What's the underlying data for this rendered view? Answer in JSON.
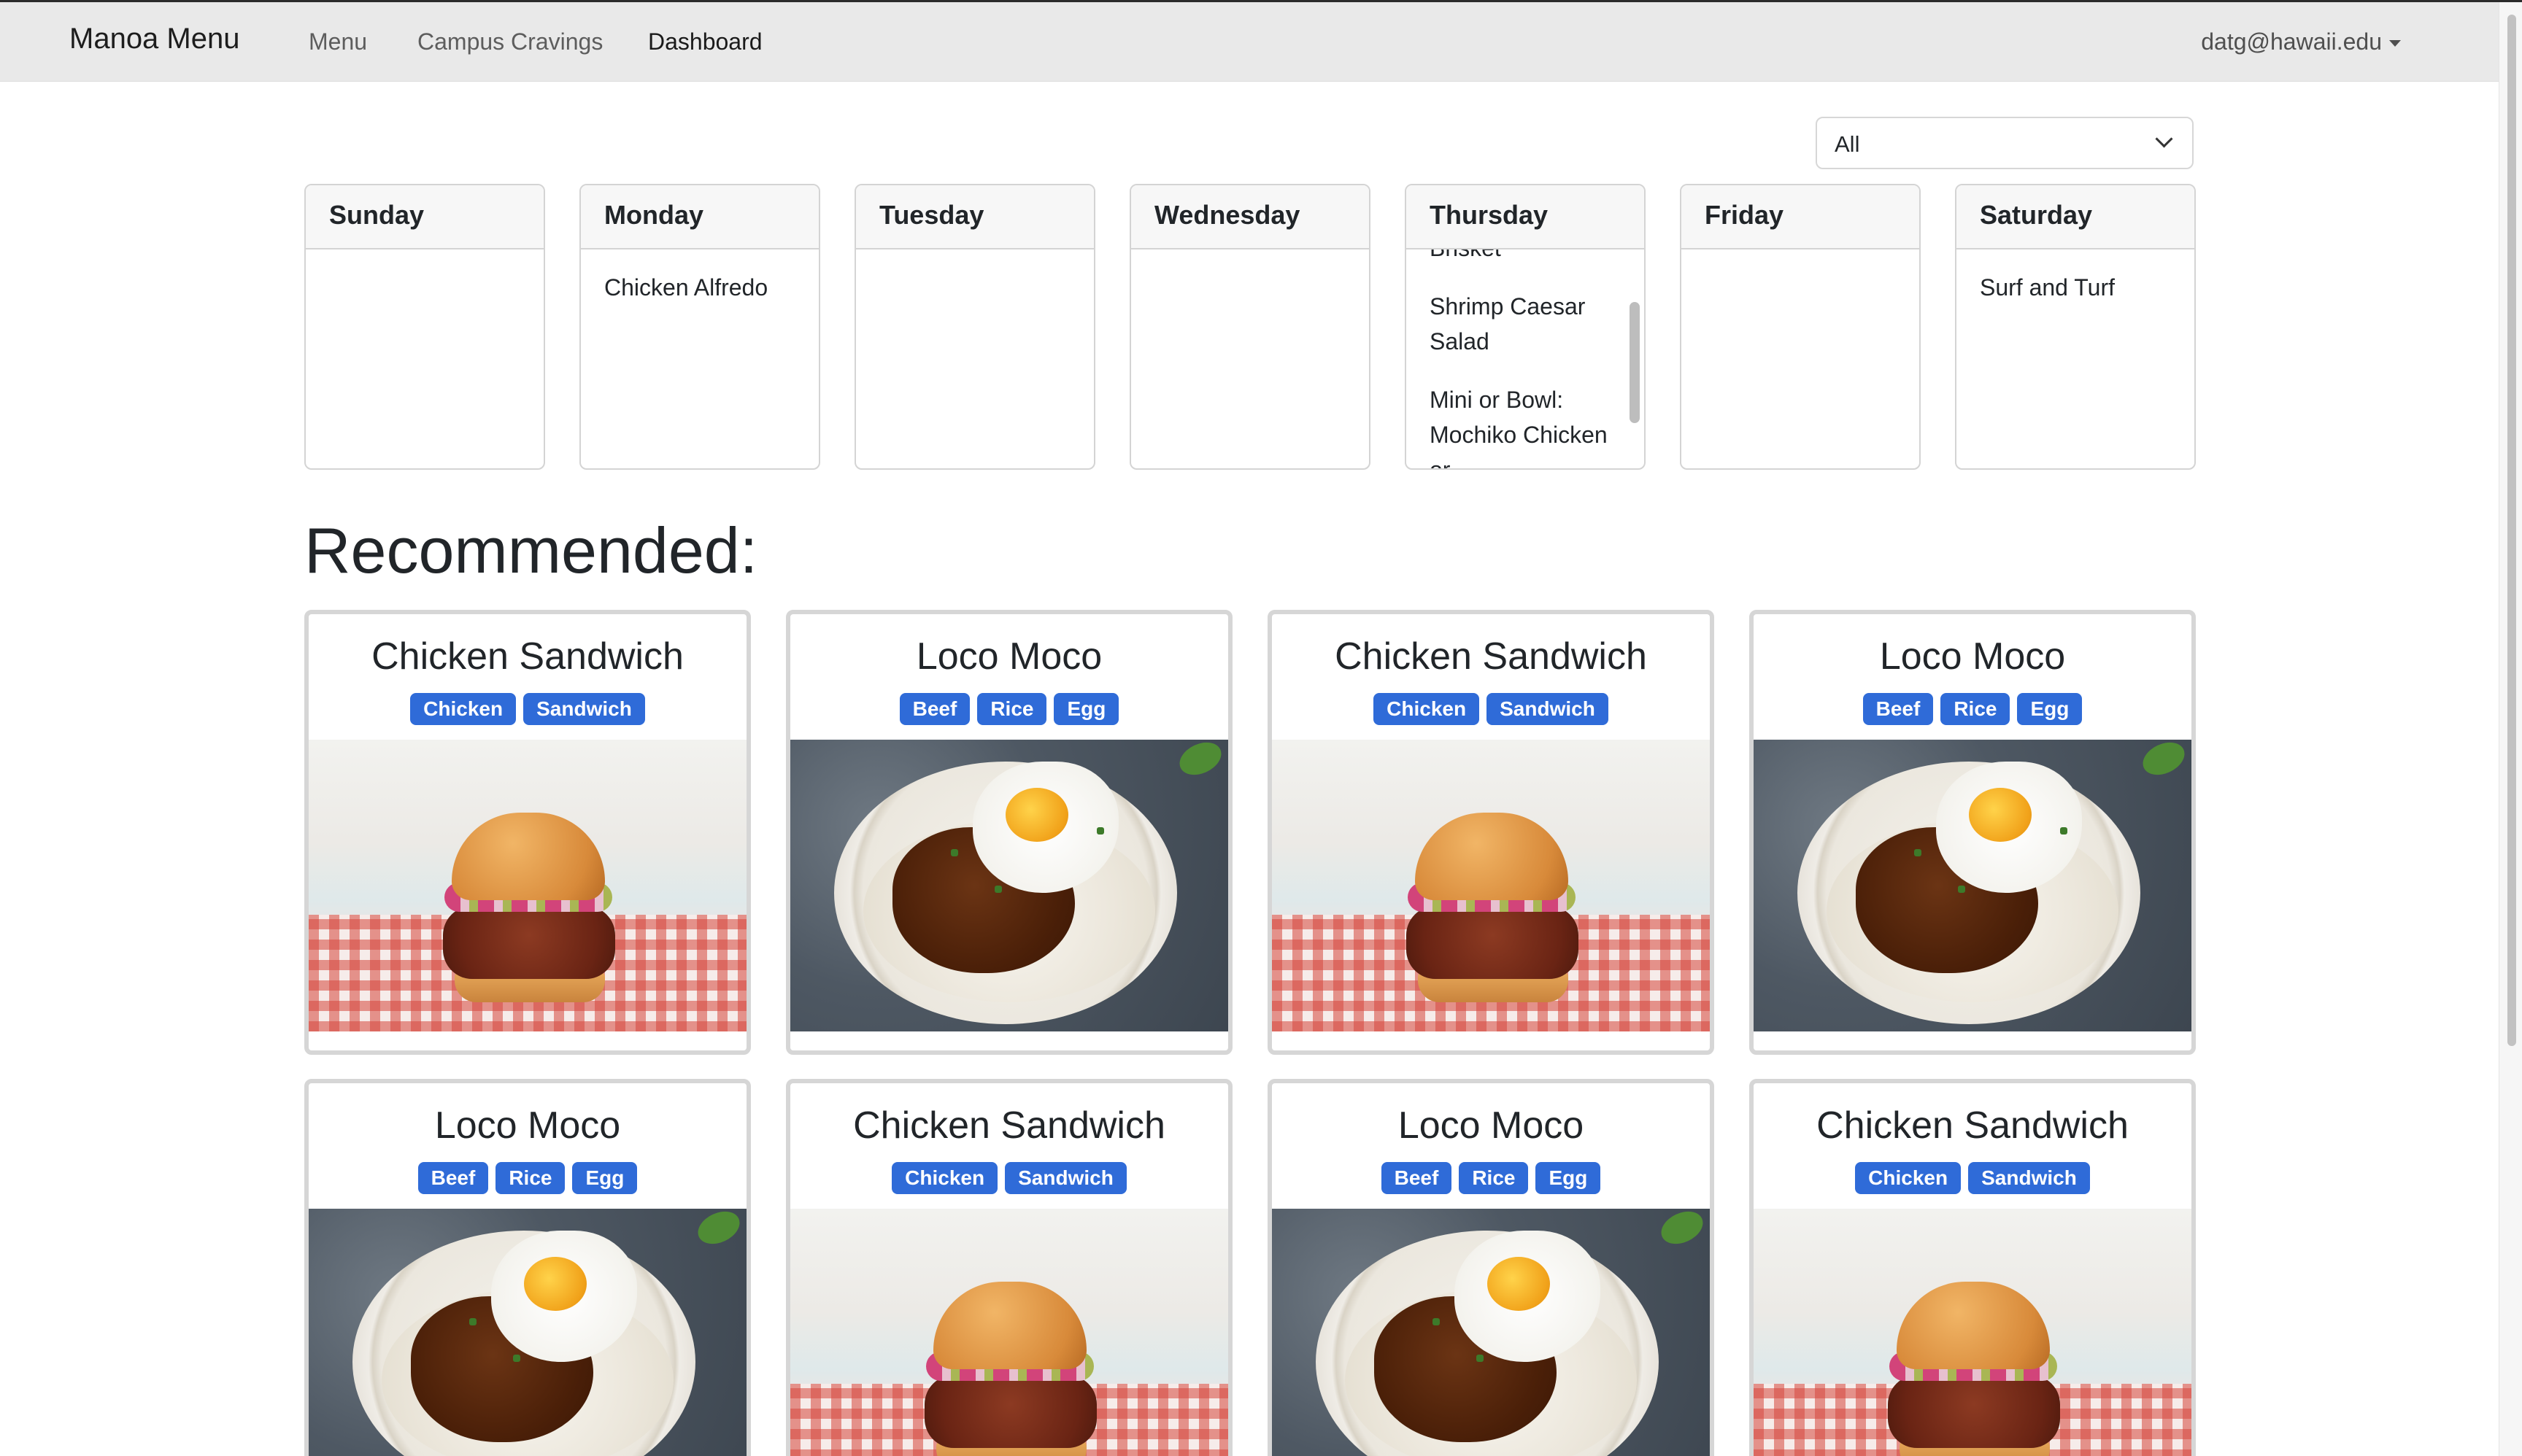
{
  "navbar": {
    "brand": "Manoa Menu",
    "links": [
      "Menu",
      "Campus Cravings",
      "Dashboard"
    ],
    "active_link": "Dashboard",
    "user": "datg@hawaii.edu"
  },
  "filter": {
    "selected": "All"
  },
  "week": [
    {
      "day": "Sunday",
      "items": []
    },
    {
      "day": "Monday",
      "items": [
        "Chicken Alfredo"
      ]
    },
    {
      "day": "Tuesday",
      "items": []
    },
    {
      "day": "Wednesday",
      "items": []
    },
    {
      "day": "Thursday",
      "items": [
        "Brisket",
        "Shrimp Caesar Salad",
        "Mini or Bowl: Mochiko Chicken or"
      ]
    },
    {
      "day": "Friday",
      "items": []
    },
    {
      "day": "Saturday",
      "items": [
        "Surf and Turf"
      ]
    }
  ],
  "recommended": {
    "heading": "Recommended:",
    "cards": [
      {
        "title": "Chicken Sandwich",
        "tags": [
          "Chicken",
          "Sandwich"
        ],
        "image": "chicken-sandwich"
      },
      {
        "title": "Loco Moco",
        "tags": [
          "Beef",
          "Rice",
          "Egg"
        ],
        "image": "loco-moco"
      },
      {
        "title": "Chicken Sandwich",
        "tags": [
          "Chicken",
          "Sandwich"
        ],
        "image": "chicken-sandwich"
      },
      {
        "title": "Loco Moco",
        "tags": [
          "Beef",
          "Rice",
          "Egg"
        ],
        "image": "loco-moco"
      },
      {
        "title": "Loco Moco",
        "tags": [
          "Beef",
          "Rice",
          "Egg"
        ],
        "image": "loco-moco"
      },
      {
        "title": "Chicken Sandwich",
        "tags": [
          "Chicken",
          "Sandwich"
        ],
        "image": "chicken-sandwich"
      },
      {
        "title": "Loco Moco",
        "tags": [
          "Beef",
          "Rice",
          "Egg"
        ],
        "image": "loco-moco"
      },
      {
        "title": "Chicken Sandwich",
        "tags": [
          "Chicken",
          "Sandwich"
        ],
        "image": "chicken-sandwich"
      }
    ]
  },
  "colors": {
    "tag": "#2f6bd8",
    "navbar": "#e9e9e9"
  }
}
